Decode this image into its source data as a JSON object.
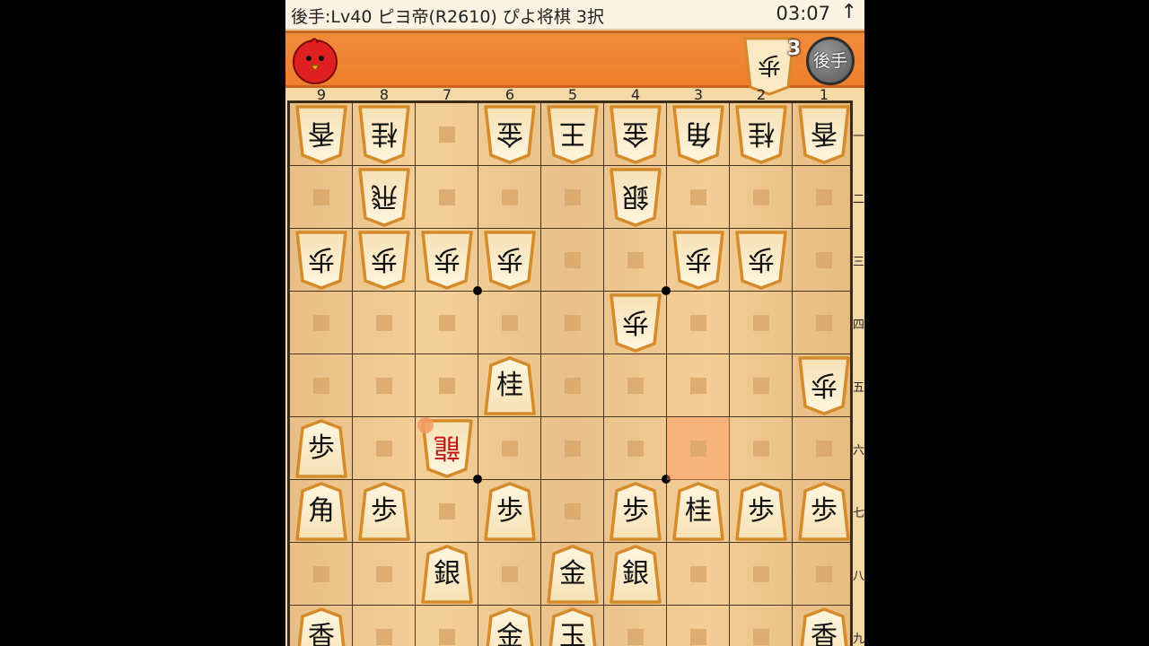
{
  "status_bar": {
    "title": "後手:Lv40 ピヨ帝(R2610)  ぴよ将棋 3択",
    "time": "03:07",
    "arrow": "↑"
  },
  "opponent_bar": {
    "avatar_icon": "piyo-chick-icon",
    "hand_piece": "歩",
    "hand_count": "3",
    "side_badge": "後手"
  },
  "board": {
    "col_labels": [
      "9",
      "8",
      "7",
      "6",
      "5",
      "4",
      "3",
      "2",
      "1"
    ],
    "row_labels": [
      "一",
      "二",
      "三",
      "四",
      "五",
      "六",
      "七",
      "八",
      "九"
    ],
    "highlight": {
      "col": "3",
      "row": "六"
    },
    "pieces": [
      {
        "col": "9",
        "row": "一",
        "char": "香",
        "side": "gote"
      },
      {
        "col": "8",
        "row": "一",
        "char": "桂",
        "side": "gote"
      },
      {
        "col": "6",
        "row": "一",
        "char": "金",
        "side": "gote"
      },
      {
        "col": "5",
        "row": "一",
        "char": "王",
        "side": "gote"
      },
      {
        "col": "4",
        "row": "一",
        "char": "金",
        "side": "gote"
      },
      {
        "col": "3",
        "row": "一",
        "char": "角",
        "side": "gote"
      },
      {
        "col": "2",
        "row": "一",
        "char": "桂",
        "side": "gote"
      },
      {
        "col": "1",
        "row": "一",
        "char": "香",
        "side": "gote"
      },
      {
        "col": "8",
        "row": "二",
        "char": "飛",
        "side": "gote"
      },
      {
        "col": "4",
        "row": "二",
        "char": "銀",
        "side": "gote"
      },
      {
        "col": "9",
        "row": "三",
        "char": "歩",
        "side": "gote"
      },
      {
        "col": "8",
        "row": "三",
        "char": "歩",
        "side": "gote"
      },
      {
        "col": "7",
        "row": "三",
        "char": "歩",
        "side": "gote"
      },
      {
        "col": "6",
        "row": "三",
        "char": "歩",
        "side": "gote"
      },
      {
        "col": "3",
        "row": "三",
        "char": "歩",
        "side": "gote"
      },
      {
        "col": "2",
        "row": "三",
        "char": "歩",
        "side": "gote"
      },
      {
        "col": "4",
        "row": "四",
        "char": "歩",
        "side": "gote"
      },
      {
        "col": "1",
        "row": "五",
        "char": "歩",
        "side": "gote"
      },
      {
        "col": "6",
        "row": "五",
        "char": "桂",
        "side": "sente"
      },
      {
        "col": "9",
        "row": "六",
        "char": "歩",
        "side": "sente"
      },
      {
        "col": "7",
        "row": "六",
        "char": "龍",
        "side": "gote",
        "promoted": true,
        "touched": true
      },
      {
        "col": "9",
        "row": "七",
        "char": "角",
        "side": "sente"
      },
      {
        "col": "8",
        "row": "七",
        "char": "歩",
        "side": "sente"
      },
      {
        "col": "6",
        "row": "七",
        "char": "歩",
        "side": "sente"
      },
      {
        "col": "4",
        "row": "七",
        "char": "歩",
        "side": "sente"
      },
      {
        "col": "3",
        "row": "七",
        "char": "桂",
        "side": "sente"
      },
      {
        "col": "2",
        "row": "七",
        "char": "歩",
        "side": "sente"
      },
      {
        "col": "1",
        "row": "七",
        "char": "歩",
        "side": "sente"
      },
      {
        "col": "7",
        "row": "八",
        "char": "銀",
        "side": "sente"
      },
      {
        "col": "5",
        "row": "八",
        "char": "金",
        "side": "sente"
      },
      {
        "col": "4",
        "row": "八",
        "char": "銀",
        "side": "sente"
      },
      {
        "col": "9",
        "row": "九",
        "char": "香",
        "side": "sente"
      },
      {
        "col": "6",
        "row": "九",
        "char": "金",
        "side": "sente"
      },
      {
        "col": "5",
        "row": "九",
        "char": "玉",
        "side": "sente"
      },
      {
        "col": "1",
        "row": "九",
        "char": "香",
        "side": "sente"
      }
    ]
  },
  "colors": {
    "bar_orange": "#ee7f2c",
    "board_wood": "#f0ca92",
    "promoted_red": "#c01818",
    "highlight": "#ff965a"
  }
}
